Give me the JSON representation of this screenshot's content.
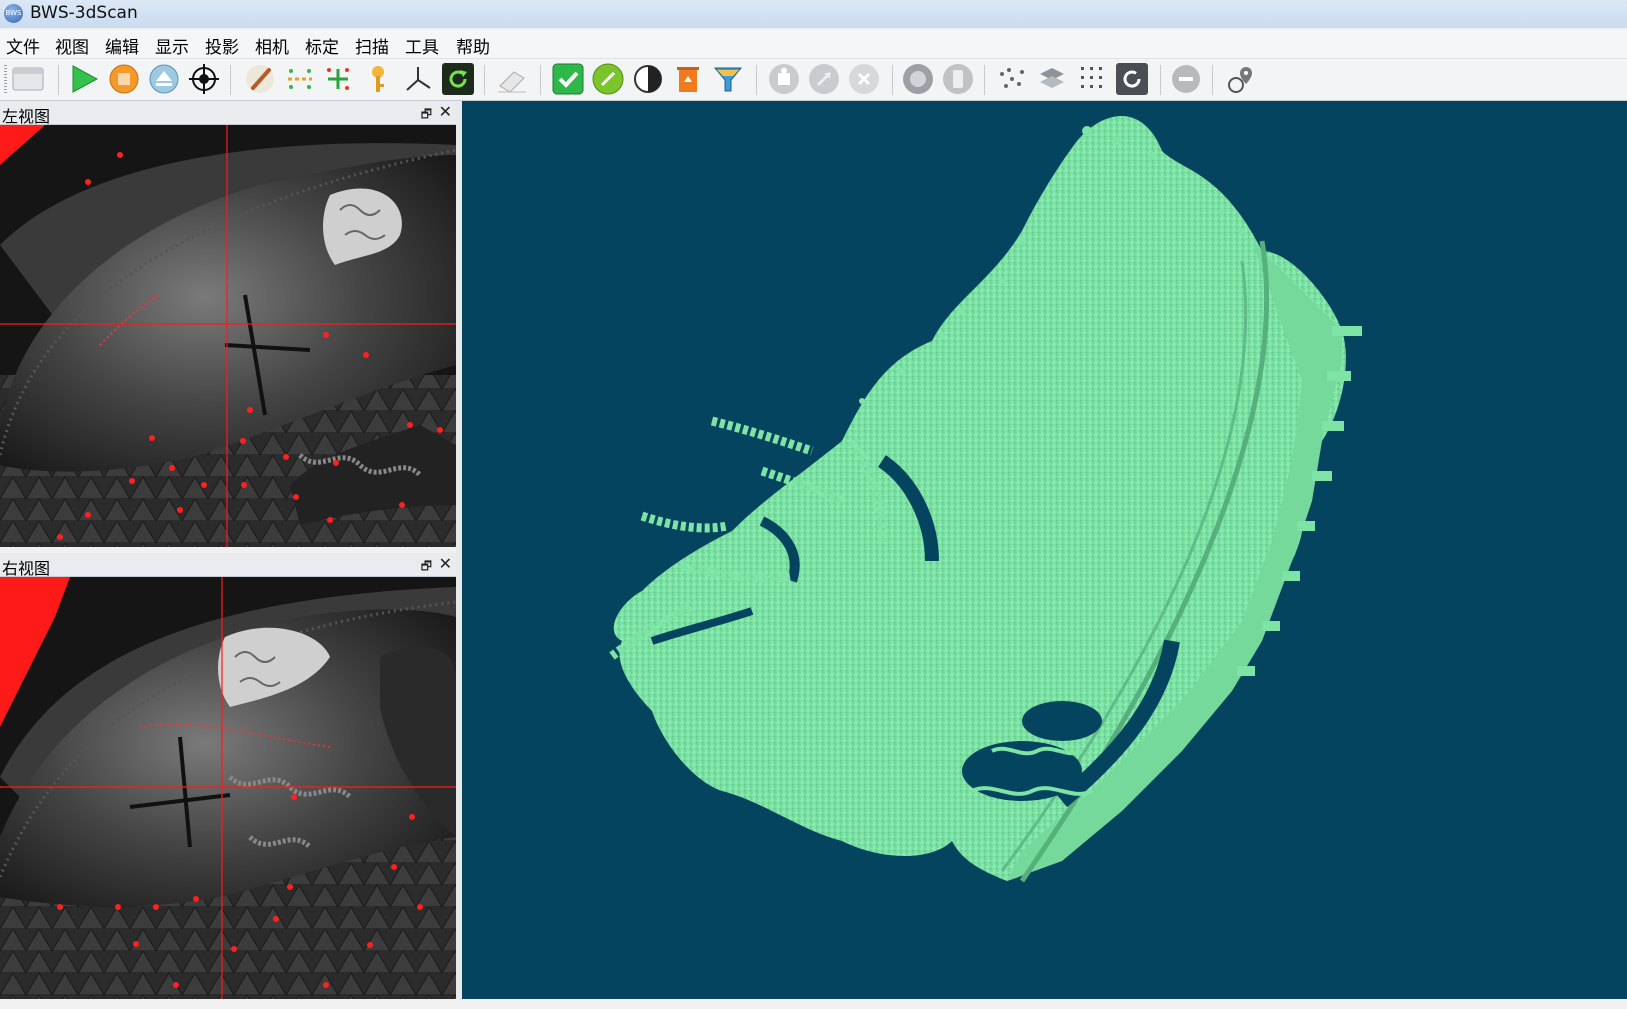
{
  "window": {
    "title": "BWS-3dScan",
    "logo_text": "BWS"
  },
  "menu": [
    "文件",
    "视图",
    "编辑",
    "显示",
    "投影",
    "相机",
    "标定",
    "扫描",
    "工具",
    "帮助"
  ],
  "toolbar": {
    "buttons": [
      "new-window-icon",
      "play-icon",
      "stop-icon",
      "eject-icon",
      "crosshair-target-icon",
      "brush-icon",
      "dashed-line-icon",
      "add-points-icon",
      "key-icon",
      "axes-icon",
      "refresh-icon",
      "eraser-icon",
      "confirm-check-icon",
      "edit-pencil-icon",
      "contrast-icon",
      "recycle-bin-icon",
      "filter-funnel-icon",
      "puzzle-icon",
      "expand-arrows-icon",
      "cancel-icon",
      "sphere-icon",
      "mobile-device-icon",
      "scatter-points-icon",
      "layers-icon",
      "grid-dots-icon",
      "refresh-gray-icon",
      "minus-icon",
      "location-pin-icon"
    ]
  },
  "panels": {
    "left": {
      "title": "左视图"
    },
    "right": {
      "title": "右视图"
    }
  },
  "statusbar": {
    "text": ""
  },
  "colors": {
    "viewport_bg": "#05445e",
    "scan_surface": "#7ee4a6",
    "crosshair": "#ff1a1a"
  }
}
